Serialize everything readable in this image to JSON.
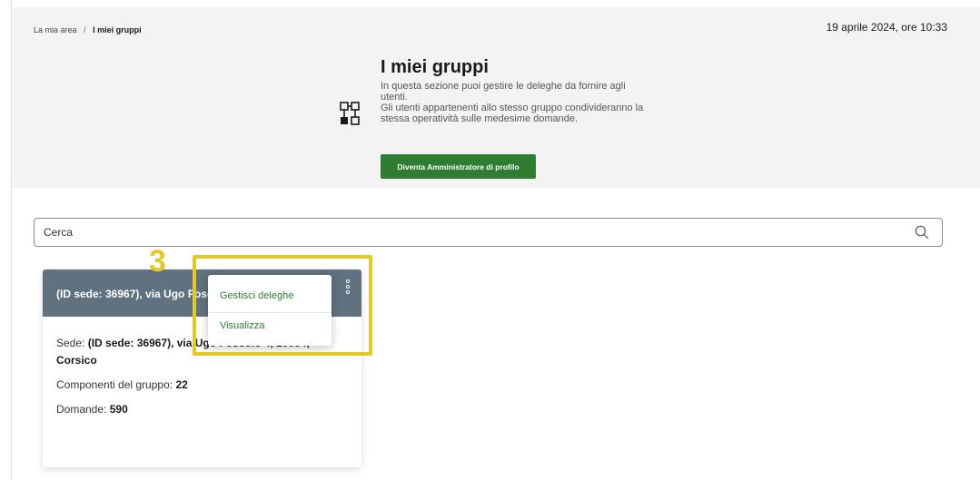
{
  "breadcrumb": {
    "root": "La mia area",
    "separator": "/",
    "current": "I miei gruppi"
  },
  "datetime": "19 aprile 2024, ore 10:33",
  "hero": {
    "title": "I miei gruppi",
    "desc_line1": "In questa sezione puoi gestire le deleghe da fornire agli utenti.",
    "desc_line2": "Gli utenti appartenenti allo stesso gruppo condivideranno la stessa operatività sulle medesime domande.",
    "admin_button": "Diventa Amministratore di profilo",
    "icon": "group-icon"
  },
  "search": {
    "placeholder": "Cerca",
    "value": "",
    "icon": "search-icon"
  },
  "card": {
    "header_title": "(ID sede: 36967), via Ugo Foscolo 4, 20094, Corsico",
    "sede_label": "Sede:",
    "sede_value": "(ID sede: 36967), via Ugo Foscolo 4, 20094,",
    "sede_city": "Corsico",
    "components_label": "Componenti del gruppo:",
    "components_value": "22",
    "requests_label": "Domande:",
    "requests_value": "590",
    "header_color": "#607180"
  },
  "dropdown": {
    "items": [
      "Gestisci deleghe",
      "Visualizza"
    ]
  },
  "annotation": {
    "step": "3",
    "color": "#e1c927"
  },
  "colors": {
    "primary_green": "#2e7d32"
  }
}
